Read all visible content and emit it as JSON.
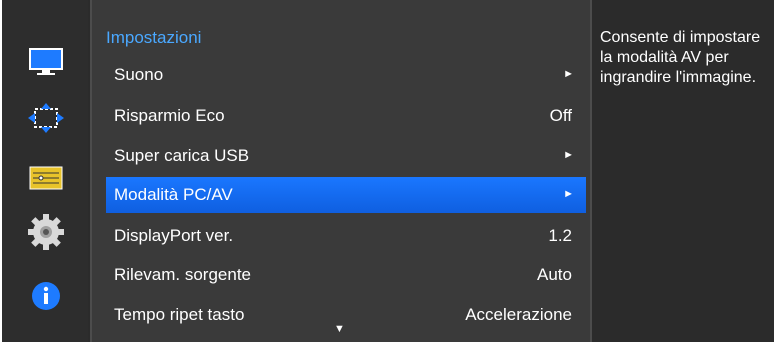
{
  "menu": {
    "title": "Impostazioni",
    "items": [
      {
        "label": "Suono",
        "value": "",
        "arrow": "►"
      },
      {
        "label": "Risparmio Eco",
        "value": "Off",
        "arrow": ""
      },
      {
        "label": "Super carica USB",
        "value": "",
        "arrow": "►"
      },
      {
        "label": "Modalità PC/AV",
        "value": "",
        "arrow": "►"
      },
      {
        "label": "DisplayPort ver.",
        "value": "1.2",
        "arrow": ""
      },
      {
        "label": "Rilevam. sorgente",
        "value": "Auto",
        "arrow": ""
      },
      {
        "label": "Tempo ripet tasto",
        "value": "Accelerazione",
        "arrow": ""
      }
    ],
    "scroll_indicator": "▼"
  },
  "sidebar": {
    "icons": [
      "monitor-icon",
      "resize-icon",
      "sliders-icon",
      "gear-icon",
      "info-icon"
    ]
  },
  "info": {
    "text": "Consente di impostare la modalità AV per ingrandire l'immagine."
  },
  "colors": {
    "accent": "#1a77ff",
    "title": "#4aa8ff",
    "background": "#2b2b2b"
  }
}
